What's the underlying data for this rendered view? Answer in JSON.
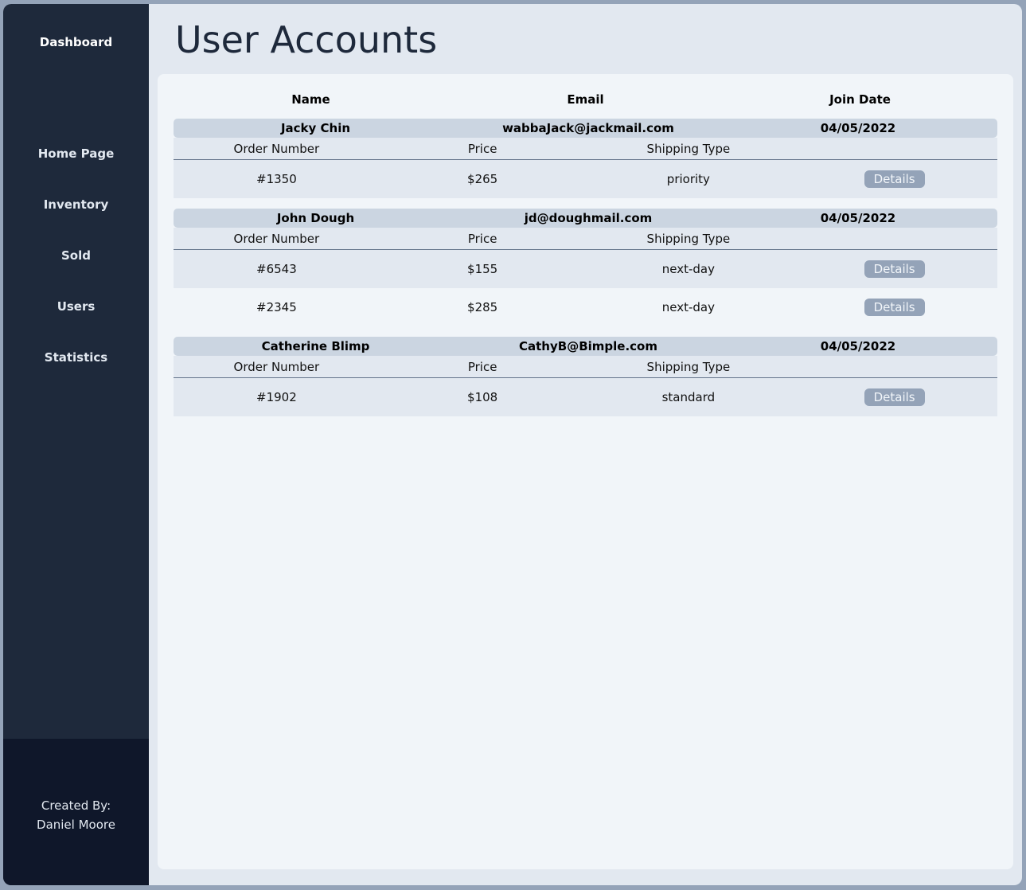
{
  "sidebar": {
    "brand": "Dashboard",
    "nav": [
      {
        "label": "Home Page"
      },
      {
        "label": "Inventory"
      },
      {
        "label": "Sold"
      },
      {
        "label": "Users"
      },
      {
        "label": "Statistics"
      }
    ],
    "footer_line1": "Created By:",
    "footer_line2": "Daniel Moore"
  },
  "page": {
    "title": "User Accounts"
  },
  "table": {
    "headers": {
      "name": "Name",
      "email": "Email",
      "join_date": "Join Date"
    },
    "order_headers": {
      "order_number": "Order Number",
      "price": "Price",
      "shipping_type": "Shipping Type"
    },
    "details_label": "Details",
    "users": [
      {
        "name": "Jacky Chin",
        "email": "wabbaJack@jackmail.com",
        "join_date": "04/05/2022",
        "orders": [
          {
            "order_number": "#1350",
            "price": "$265",
            "shipping_type": "priority"
          }
        ]
      },
      {
        "name": "John Dough",
        "email": "jd@doughmail.com",
        "join_date": "04/05/2022",
        "orders": [
          {
            "order_number": "#6543",
            "price": "$155",
            "shipping_type": "next-day"
          },
          {
            "order_number": "#2345",
            "price": "$285",
            "shipping_type": "next-day"
          }
        ]
      },
      {
        "name": "Catherine Blimp",
        "email": "CathyB@Bimple.com",
        "join_date": "04/05/2022",
        "orders": [
          {
            "order_number": "#1902",
            "price": "$108",
            "shipping_type": "standard"
          }
        ]
      }
    ]
  }
}
